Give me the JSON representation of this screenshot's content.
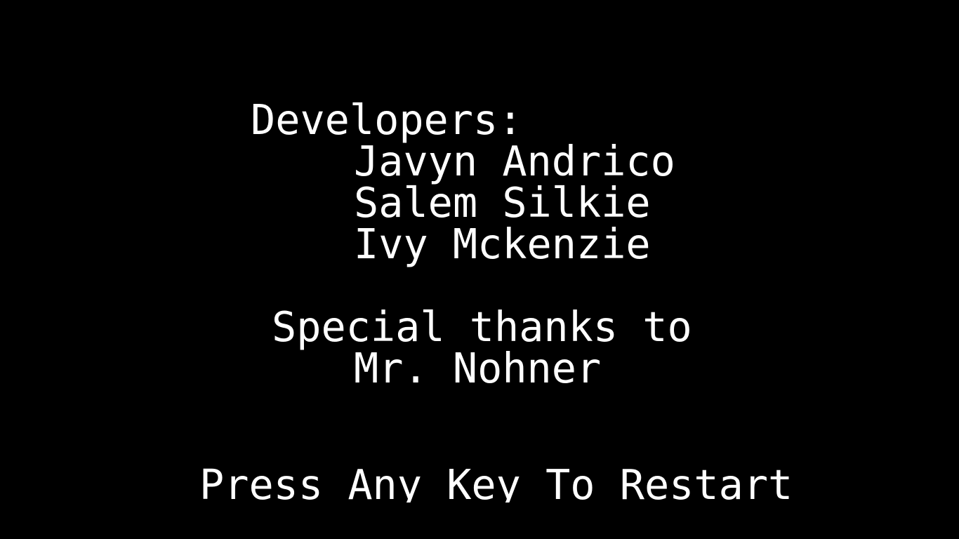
{
  "colors": {
    "background": "#000000",
    "text": "#ffffff"
  },
  "credits": {
    "developers_heading": "Developers:",
    "developers": [
      "Javyn Andrico",
      "Salem Silkie",
      "Ivy Mckenzie"
    ],
    "thanks_heading": "Special thanks to",
    "thanks_name": "Mr. Nohner"
  },
  "prompt": {
    "restart": "Press Any Key To Restart"
  }
}
